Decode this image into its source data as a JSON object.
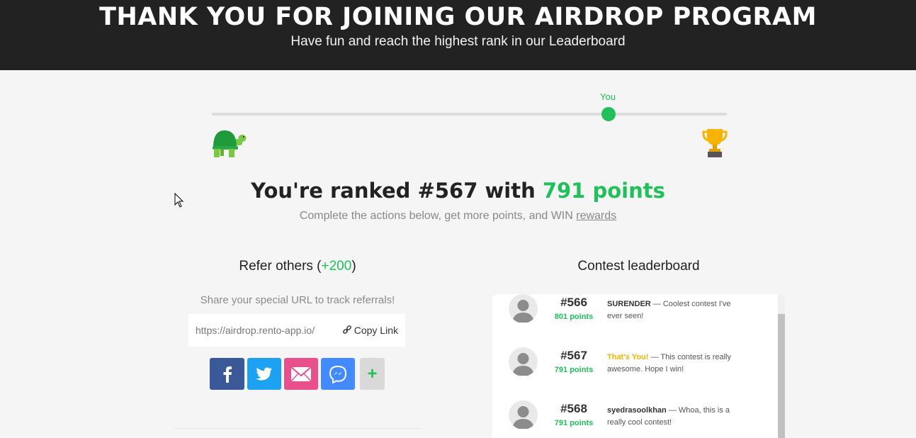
{
  "hero": {
    "title": "THANK YOU FOR JOINING OUR AIRDROP PROGRAM",
    "subtitle": "Have fun and reach the highest rank in our Leaderboard"
  },
  "progress": {
    "you_label": "You",
    "position_fraction": 0.77,
    "start_icon": "turtle-icon",
    "end_icon": "trophy-icon"
  },
  "rank": {
    "prefix": "You're ranked #567 with ",
    "points_text": "791 points",
    "subtitle_text": "Complete the actions below, get more points, and WIN ",
    "rewards_link": "rewards"
  },
  "refer": {
    "title_prefix": "Refer others (",
    "bonus": "+200",
    "title_suffix": ")",
    "hint": "Share your special URL to track referrals!",
    "url": "https://airdrop.rento-app.io/",
    "copy_label": "Copy Link",
    "socials": [
      "facebook-icon",
      "twitter-icon",
      "email-icon",
      "messenger-icon",
      "plus-icon"
    ],
    "more_label": "+"
  },
  "leaderboard": {
    "title": "Contest leaderboard",
    "entries": [
      {
        "rank": "#566",
        "points": "801 points",
        "name": "SURENDER",
        "comment": " — Coolest contest I've ever seen!"
      },
      {
        "rank": "#567",
        "points": "791 points",
        "name": "That's You!",
        "comment": " — This contest is really awesome. Hope I win!"
      },
      {
        "rank": "#568",
        "points": "791 points",
        "name": "syedrasoolkhan",
        "comment": " — Whoa, this is a really cool contest!"
      }
    ]
  },
  "colors": {
    "accent_green": "#21c05b",
    "header_bg": "#222222",
    "you_highlight": "#f0b400",
    "facebook": "#3b5998",
    "twitter": "#1da1f2",
    "email": "#e8508b",
    "messenger": "#448aff"
  }
}
